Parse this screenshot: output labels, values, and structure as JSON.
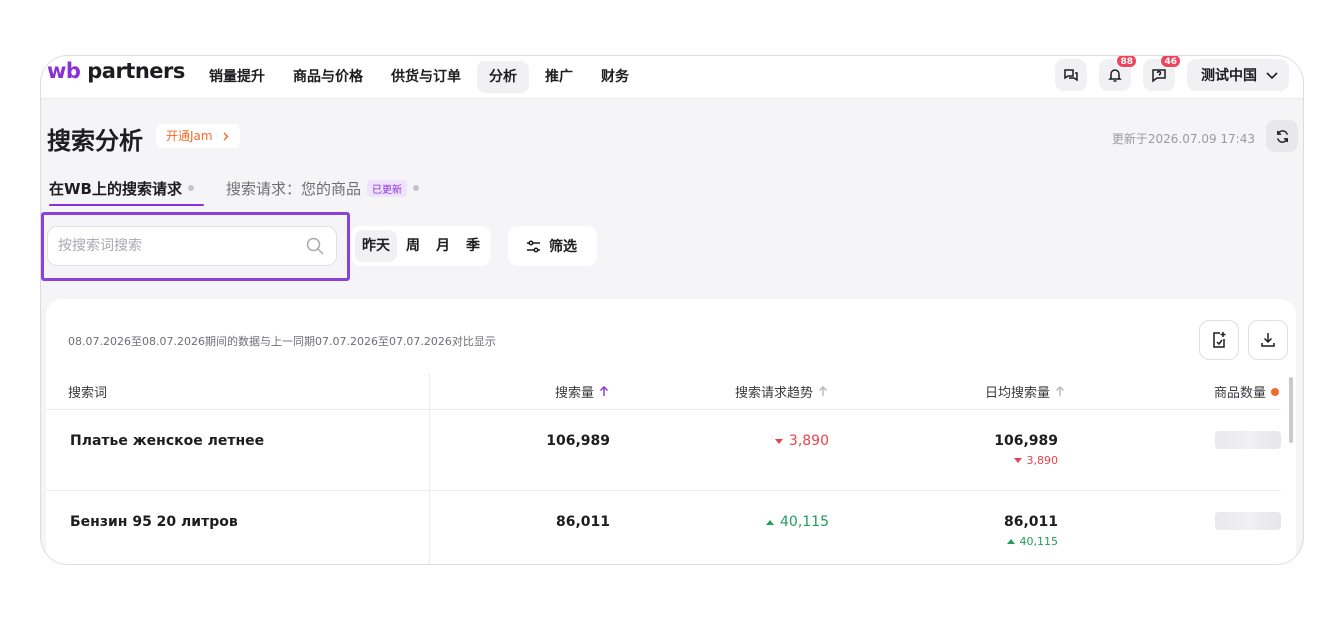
{
  "brand": {
    "logo_prefix": "wb",
    "logo_suffix": " partners",
    "accent": "#8b2fd8"
  },
  "nav": {
    "items": [
      {
        "label": "销量提升",
        "active": false
      },
      {
        "label": "商品与价格",
        "active": false
      },
      {
        "label": "供货与订单",
        "active": false
      },
      {
        "label": "分析",
        "active": true
      },
      {
        "label": "推广",
        "active": false
      },
      {
        "label": "财务",
        "active": false
      }
    ]
  },
  "top_right": {
    "chat_icon": "chat-bubbles-icon",
    "notifications_icon": "bell-icon",
    "notifications_count": "88",
    "support_icon": "question-bubble-icon",
    "support_count": "46",
    "account_name": "测试中国"
  },
  "header": {
    "title": "搜索分析",
    "jam_label": "开通Jam",
    "updated_text": "更新于2026.07.09 17:43"
  },
  "tabs": [
    {
      "label": "在WB上的搜索请求",
      "active": true,
      "tag": ""
    },
    {
      "label": "搜索请求：您的商品",
      "active": false,
      "tag": "已更新"
    }
  ],
  "search": {
    "placeholder": "按搜索词搜索",
    "value": ""
  },
  "periods": [
    {
      "label": "昨天",
      "active": true
    },
    {
      "label": "周",
      "active": false
    },
    {
      "label": "月",
      "active": false
    },
    {
      "label": "季",
      "active": false
    }
  ],
  "filter_label": "筛选",
  "card": {
    "period_note": "08.07.2026至08.07.2026期间的数据与上一同期07.07.2026至07.07.2026对比显示"
  },
  "table": {
    "headers": {
      "query": "搜索词",
      "volume": "搜索量",
      "trend": "搜索请求趋势",
      "daily": "日均搜索量",
      "products": "商品数量"
    },
    "rows": [
      {
        "query": "Платье женское летнее",
        "volume": "106,989",
        "trend": "3,890",
        "trend_dir": "down",
        "daily": "106,989",
        "daily_trend": "3,890",
        "daily_dir": "down"
      },
      {
        "query": "Бензин 95 20 литров",
        "volume": "86,011",
        "trend": "40,115",
        "trend_dir": "up",
        "daily": "86,011",
        "daily_trend": "40,115",
        "daily_dir": "up"
      }
    ]
  }
}
